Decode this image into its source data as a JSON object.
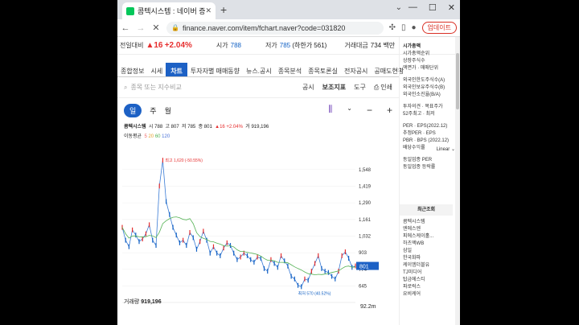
{
  "browser": {
    "tab_title": "콤텍시스템 : 네이버 증권",
    "url": "finance.naver.com/item/fchart.naver?code=031820",
    "update_label": "업데이트",
    "new_tab": "+",
    "min": "—",
    "max": "☐",
    "close": "✕"
  },
  "stock_header": {
    "prev_label": "전일대비",
    "prev_change": "▲16",
    "prev_pct": "+2.04%",
    "open_label": "시가",
    "open_val": "788",
    "low_label": "저가",
    "low_val": "785",
    "low_limit": "(하한가 561)",
    "amount_label": "거래대금",
    "amount_val": "734 백만"
  },
  "menu": {
    "items": [
      "종합정보",
      "시세",
      "차트",
      "투자자별 매매동향",
      "뉴스.공시",
      "종목분석",
      "종목토론실",
      "전자공시",
      "공매도현황"
    ],
    "active_index": 2
  },
  "compare": {
    "placeholder": "종목 또는 지수비교",
    "tools": [
      "공시",
      "보조지표",
      "도구",
      "인쇄"
    ]
  },
  "periods": [
    "일",
    "주",
    "월"
  ],
  "info": {
    "name": "콤텍시스템",
    "open": "시 788",
    "high": "고 807",
    "low": "저 785",
    "close": "종 801",
    "change": "▲16 +2.04%",
    "volume": "거 919,196",
    "ma_label": "이동평균",
    "ma": [
      "5",
      "20",
      "60",
      "120"
    ]
  },
  "chart_data": {
    "type": "line",
    "scale": "Linear",
    "y_ticks": [
      1548,
      1419,
      1290,
      1161,
      1032,
      903,
      774,
      645
    ],
    "ylim": [
      580,
      1640
    ],
    "current_price": 801,
    "high_annotation": "최고 1,620 (-50.55%)",
    "low_annotation": "최저 570 (40.52%)",
    "close_series": [
      1100,
      1000,
      950,
      1080,
      1040,
      990,
      1010,
      1050,
      1120,
      1000,
      960,
      1420,
      1620,
      1300,
      1200,
      1100,
      1040,
      980,
      1000,
      960,
      1060,
      1020,
      930,
      990,
      1070,
      1000,
      900,
      950,
      900,
      880,
      940,
      980,
      960,
      900,
      850,
      870,
      900,
      880,
      850,
      830,
      870,
      860,
      780,
      760,
      850,
      820,
      790,
      880,
      840,
      800,
      720,
      700,
      650,
      640,
      700,
      690,
      760,
      820,
      880,
      780,
      760,
      750,
      720,
      700,
      760,
      880,
      910,
      860,
      790,
      801
    ]
  },
  "volume": {
    "label": "거래량",
    "value": "919,196",
    "axis_max": "92.2m"
  },
  "right_col": {
    "sections": [
      {
        "title": "시가총액",
        "items": [
          "시가총액순위",
          "상장주식수",
          "액면가 · 매매단위"
        ]
      },
      {
        "title": "",
        "items": [
          "외국인한도주식수(A)",
          "외국인보유주식수(B)",
          "외국인소진율(B/A)"
        ]
      },
      {
        "title": "",
        "items": [
          "투자의견 · 목표주가",
          "52주최고 · 최저"
        ]
      },
      {
        "title": "",
        "items": [
          "PER · EPS(2022.12)",
          "추정PER · EPS",
          "PBR · BPS (2022.12)",
          "배당수익률"
        ]
      },
      {
        "title": "",
        "items": [
          "동일업종 PER",
          "동일업종 등락률"
        ]
      }
    ],
    "recent_title": "최근조회",
    "recent": [
      "콤텍시스템",
      "엔에스엔",
      "피에스케이홀...",
      "하츠엑WB",
      "삼일",
      "한국화파",
      "케이엠더블유",
      "TJ미디어",
      "탑금에스티",
      "파로럭스",
      "요비케어"
    ]
  }
}
